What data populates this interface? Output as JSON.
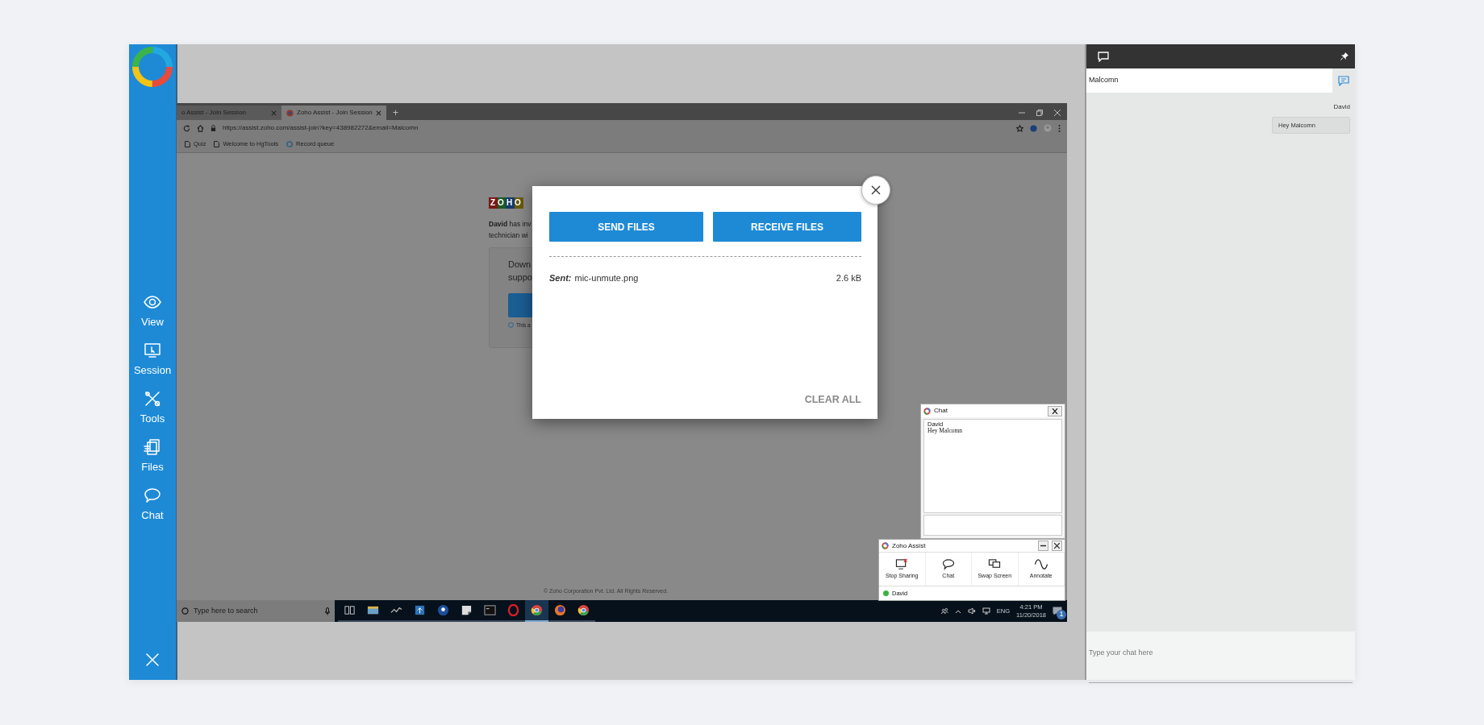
{
  "sidebar": {
    "items": [
      {
        "label": "View",
        "kind": "view"
      },
      {
        "label": "Session",
        "kind": "session"
      },
      {
        "label": "Tools",
        "kind": "tools"
      },
      {
        "label": "Files",
        "kind": "files"
      },
      {
        "label": "Chat",
        "kind": "chat"
      }
    ]
  },
  "remote_screen": {
    "browser": {
      "tabs": [
        {
          "label": "o Assist - Join Session",
          "selected": false
        },
        {
          "label": "Zoho Assist - Join Session",
          "selected": true
        }
      ],
      "new_tab": "+",
      "url": "https://assist.zoho.com/assist-join?key=438982272&email=Malcomn",
      "bookmarks": [
        "Quiz",
        "Welcome to HgTools",
        "Record queue"
      ]
    },
    "page": {
      "logo": "ZOHO",
      "intro_lines": [
        "**David** has inv",
        "technician wi"
      ],
      "card_lines": [
        "Down",
        "suppo"
      ],
      "card_note": "This a",
      "footer": "© Zoho Corporation Pvt. Ltd. All Rights Reserved."
    },
    "taskbar": {
      "search_placeholder": "Type here to search",
      "apps": [
        {
          "kind": "taskview",
          "selected": false
        },
        {
          "kind": "folder",
          "selected": false
        },
        {
          "kind": "chart",
          "selected": false
        },
        {
          "kind": "upload",
          "selected": false
        },
        {
          "kind": "pin",
          "selected": false
        },
        {
          "kind": "note",
          "selected": false
        },
        {
          "kind": "terminal",
          "selected": false
        },
        {
          "kind": "ring",
          "selected": false
        },
        {
          "kind": "chrome",
          "selected": true
        },
        {
          "kind": "fox",
          "selected": false
        },
        {
          "kind": "chrome",
          "selected": false
        }
      ],
      "language": "ENG",
      "time": "4:21 PM",
      "date": "11/20/2018",
      "notifications": "1"
    },
    "chat_window": {
      "title": "Chat",
      "messages": [
        {
          "sender": "David",
          "text": "Hey Malcomn"
        }
      ]
    },
    "assist_toolbar": {
      "title": "Zoho Assist",
      "actions": [
        {
          "label": "Stop Sharing",
          "kind": "stop"
        },
        {
          "label": "Chat",
          "kind": "chat"
        },
        {
          "label": "Swap Screen",
          "kind": "swap"
        },
        {
          "label": "Annotate",
          "kind": "annotate"
        }
      ],
      "participants": [
        {
          "name": "David",
          "online": true
        }
      ]
    },
    "file_dialog": {
      "buttons": [
        "SEND FILES",
        "RECEIVE FILES"
      ],
      "files": [
        {
          "label": "Sent:",
          "name": "mic-unmute.png",
          "size": "2.6 kB"
        }
      ],
      "clear_all": "CLEAR ALL"
    }
  },
  "chat_panel": {
    "contact": "Malcomn",
    "messages": [
      {
        "sender": "David",
        "text": "Hey Malcomn"
      }
    ],
    "placeholder": "Type your chat here"
  }
}
